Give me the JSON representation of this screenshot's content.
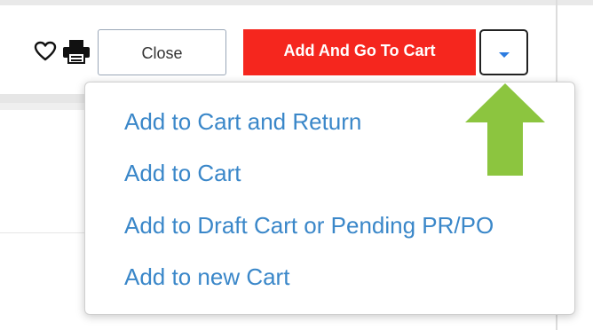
{
  "toolbar": {
    "close_label": "Close",
    "add_and_go_label": "Add And Go To Cart",
    "icons": {
      "favorite": "heart-outline-icon",
      "print": "printer-icon",
      "dropdown": "caret-down-icon"
    }
  },
  "menu": {
    "items": [
      {
        "label": "Add to Cart and Return"
      },
      {
        "label": "Add to Cart"
      },
      {
        "label": "Add to Draft Cart or Pending PR/PO"
      },
      {
        "label": "Add to new Cart"
      }
    ]
  },
  "annotation": {
    "arrow_icon": "up-arrow-icon",
    "arrow_color": "#8cc53f"
  },
  "colors": {
    "primary_button": "#f5261e",
    "menu_link": "#3a87c9",
    "caret": "#2d7ce0"
  }
}
